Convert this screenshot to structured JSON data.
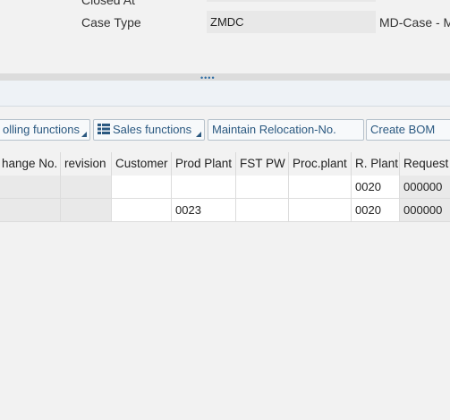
{
  "form": {
    "closed_at_label": "Closed At",
    "case_type_label": "Case Type",
    "case_type_value": "ZMDC",
    "case_type_desc": "MD-Case - M"
  },
  "splitter": {
    "grip": "••••"
  },
  "toolbar": {
    "buttons": [
      {
        "label": "olling functions",
        "has_menu": true
      },
      {
        "label": "Sales functions",
        "has_menu": true,
        "icon": "list-icon"
      },
      {
        "label": "Maintain Relocation-No.",
        "has_menu": false
      },
      {
        "label": "Create BOM",
        "has_menu": false
      }
    ]
  },
  "table": {
    "headers": [
      "hange No.",
      "revision",
      "Customer",
      "Prod Plant",
      "FST PW",
      "Proc.plant",
      "R. Plant",
      "Request"
    ],
    "rows": [
      [
        "",
        "",
        "",
        "",
        "",
        "",
        "0020",
        "000000"
      ],
      [
        "",
        "",
        "",
        "0023",
        "",
        "",
        "0020",
        "000000"
      ]
    ]
  }
}
